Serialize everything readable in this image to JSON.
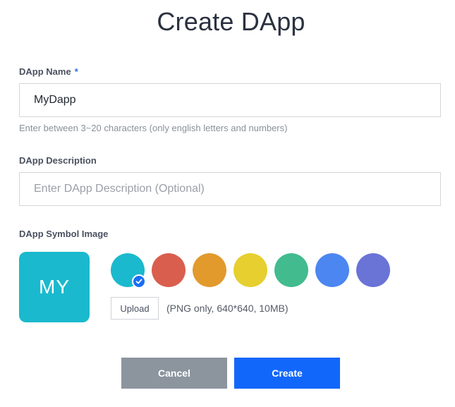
{
  "title": "Create DApp",
  "name_field": {
    "label": "DApp Name",
    "required_mark": "*",
    "value": "MyDapp",
    "hint": "Enter between 3~20 characters (only english letters and numbers)"
  },
  "description_field": {
    "label": "DApp Description",
    "placeholder": "Enter DApp Description (Optional)",
    "value": ""
  },
  "symbol": {
    "label": "DApp Symbol Image",
    "preview_text": "MY",
    "selected_color": "#1ab9cd",
    "colors": [
      "#1ab9cd",
      "#d95e4e",
      "#e29a2c",
      "#e6cf2e",
      "#42bb8f",
      "#4c86f0",
      "#6a73d6"
    ],
    "selected_index": 0,
    "upload_label": "Upload",
    "upload_note": "(PNG only, 640*640, 10MB)"
  },
  "actions": {
    "cancel_label": "Cancel",
    "cancel_color": "#8c959e",
    "create_label": "Create",
    "create_color": "#1267fb"
  }
}
